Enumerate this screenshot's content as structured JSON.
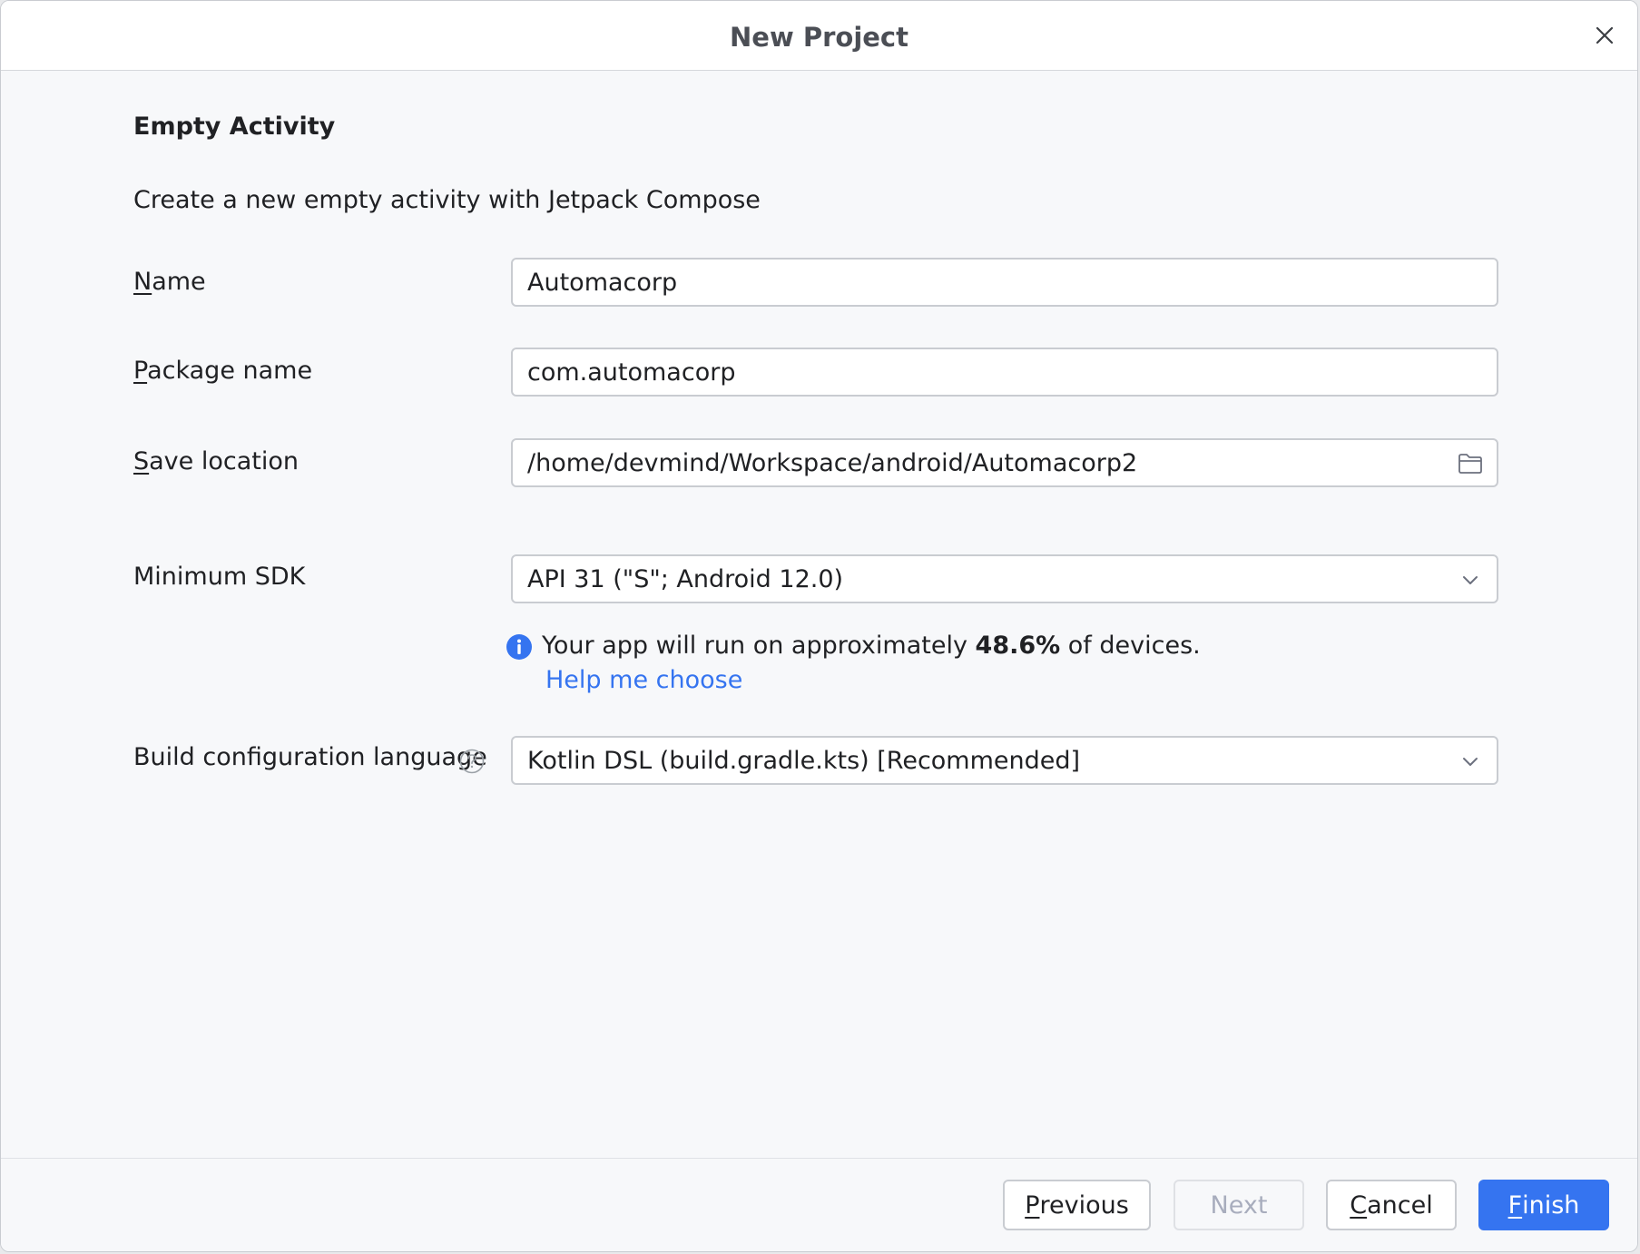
{
  "window": {
    "title": "New Project"
  },
  "template": {
    "title": "Empty Activity",
    "description": "Create a new empty activity with Jetpack Compose"
  },
  "form": {
    "name": {
      "label_mnemonic": "N",
      "label_rest": "ame",
      "value": "Automacorp"
    },
    "package": {
      "label_mnemonic": "P",
      "label_rest": "ackage name",
      "value": "com.automacorp"
    },
    "save_location": {
      "label_mnemonic": "S",
      "label_rest": "ave location",
      "value": "/home/devmind/Workspace/android/Automacorp2",
      "icon": "folder-icon"
    },
    "min_sdk": {
      "label": "Minimum SDK",
      "selected": "API 31 (\"S\"; Android 12.0)",
      "icon": "chevron-down-icon"
    },
    "info": {
      "text_before": "Your app will run on approximately ",
      "percentage": "48.6%",
      "text_after": " of devices.",
      "link": "Help me choose",
      "icon": "info-icon"
    },
    "build_language": {
      "label": "Build configuration language",
      "selected": "Kotlin DSL (build.gradle.kts) [Recommended]",
      "help_icon": "question-icon",
      "icon": "chevron-down-icon"
    }
  },
  "footer": {
    "previous": {
      "mnemonic": "P",
      "rest": "revious"
    },
    "next": {
      "label": "Next"
    },
    "cancel": {
      "mnemonic": "C",
      "rest": "ancel"
    },
    "finish": {
      "mnemonic": "F",
      "rest": "inish"
    }
  },
  "colors": {
    "accent": "#3574f0",
    "text": "#202124",
    "disabled_text": "#a8adbd",
    "title_text": "#4b4e55"
  }
}
